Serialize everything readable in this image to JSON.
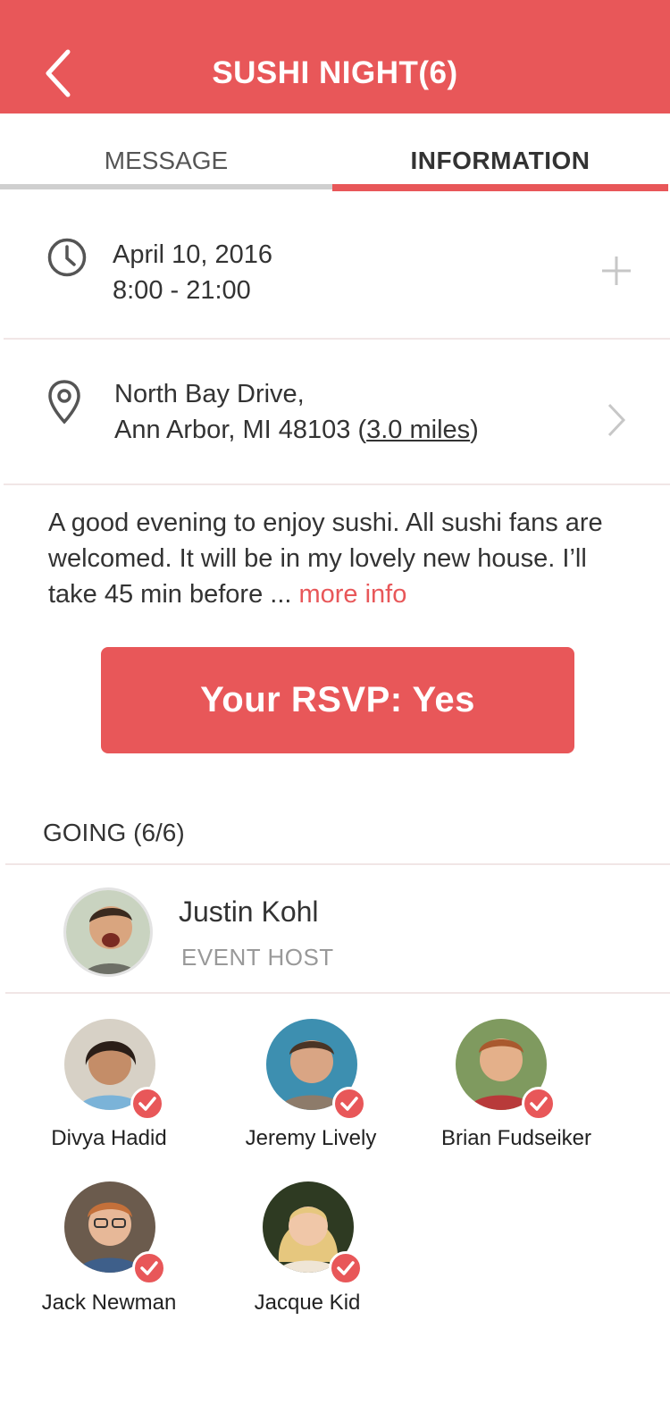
{
  "header": {
    "title": "SUSHI NIGHT(6)",
    "back_icon": "chevron-left-icon"
  },
  "tabs": [
    {
      "label": "MESSAGE",
      "active": false
    },
    {
      "label": "INFORMATION",
      "active": true
    }
  ],
  "datetime": {
    "date": "April 10, 2016",
    "time": "8:00 - 21:00",
    "icon": "clock-icon",
    "action_icon": "plus-icon"
  },
  "location": {
    "line1": "North Bay Drive,",
    "line2_prefix": "Ann Arbor, MI 48103 (",
    "distance": "3.0 miles",
    "line2_suffix": ")",
    "icon": "map-pin-icon",
    "action_icon": "chevron-right-icon"
  },
  "description": {
    "text": "A good evening to enjoy sushi. All sushi fans are welcomed. It will be in my lovely new house. I’ll take  45 min before ... ",
    "more_label": "more info"
  },
  "rsvp": {
    "label": "Your RSVP: Yes"
  },
  "going": {
    "label": "GOING (6/6)",
    "host": {
      "name": "Justin Kohl",
      "role": "EVENT HOST"
    },
    "members": [
      {
        "name": "Divya Hadid"
      },
      {
        "name": "Jeremy Lively"
      },
      {
        "name": "Brian Fudseiker"
      },
      {
        "name": "Jack Newman"
      },
      {
        "name": "Jacque Kid"
      }
    ]
  },
  "colors": {
    "accent": "#e85759",
    "tab_inactive_bar": "#cfcfcf",
    "muted_text": "#999999"
  }
}
